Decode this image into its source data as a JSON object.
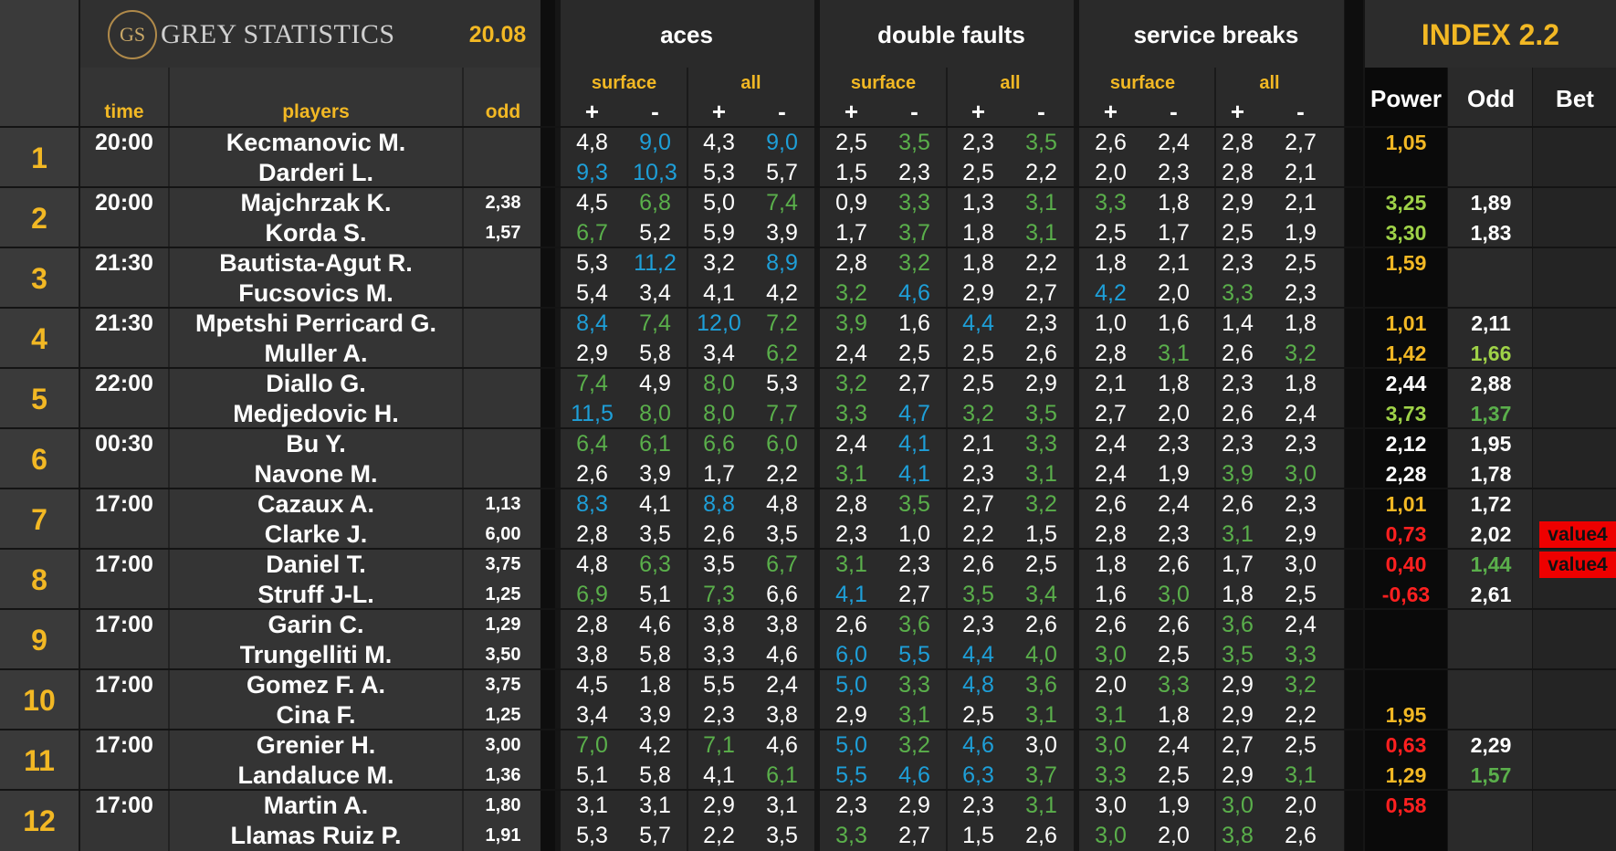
{
  "header": {
    "logo_mark": "GS",
    "logo_text": "GREY STATISTICS",
    "date": "20.08",
    "groups": [
      "aces",
      "double faults",
      "service breaks"
    ],
    "subgroups": [
      "surface",
      "all"
    ],
    "signs": [
      "+",
      "-"
    ],
    "left": {
      "time": "time",
      "players": "players",
      "odd": "odd"
    },
    "index_title": "INDEX 2.2",
    "right": {
      "power": "Power",
      "odd": "Odd",
      "bet": "Bet"
    }
  },
  "colors": {
    "white": "#ffffff",
    "green": "#5aaf4b",
    "blue": "#1e9fd8",
    "yellow": "#f2b824",
    "light_green": "#9fd248",
    "red": "#ff2020",
    "bet_bg": "#ee0000"
  },
  "matches": [
    {
      "no": "1",
      "time": "20:00",
      "players": [
        {
          "name": "Kecmanovic M.",
          "odd": "",
          "stats": [
            "4,8",
            "9,0",
            "4,3",
            "9,0",
            "2,5",
            "3,5",
            "2,3",
            "3,5",
            "2,6",
            "2,4",
            "2,8",
            "2,7"
          ],
          "colors": [
            "w",
            "b",
            "w",
            "b",
            "w",
            "g",
            "w",
            "g",
            "w",
            "w",
            "w",
            "w"
          ],
          "power": "1,05",
          "power_color": "yellow",
          "odd2": "",
          "odd2_color": "white",
          "bet": ""
        },
        {
          "name": "Darderi L.",
          "odd": "",
          "stats": [
            "9,3",
            "10,3",
            "5,3",
            "5,7",
            "1,5",
            "2,3",
            "2,5",
            "2,2",
            "2,0",
            "2,3",
            "2,8",
            "2,1"
          ],
          "colors": [
            "b",
            "b",
            "w",
            "w",
            "w",
            "w",
            "w",
            "w",
            "w",
            "w",
            "w",
            "w"
          ],
          "power": "",
          "power_color": "white",
          "odd2": "",
          "odd2_color": "white",
          "bet": ""
        }
      ]
    },
    {
      "no": "2",
      "time": "20:00",
      "players": [
        {
          "name": "Majchrzak K.",
          "odd": "2,38",
          "stats": [
            "4,5",
            "6,8",
            "5,0",
            "7,4",
            "0,9",
            "3,3",
            "1,3",
            "3,1",
            "3,3",
            "1,8",
            "2,9",
            "2,1"
          ],
          "colors": [
            "w",
            "g",
            "w",
            "g",
            "w",
            "g",
            "w",
            "g",
            "g",
            "w",
            "w",
            "w"
          ],
          "power": "3,25",
          "power_color": "light_green",
          "odd2": "1,89",
          "odd2_color": "white",
          "bet": ""
        },
        {
          "name": "Korda S.",
          "odd": "1,57",
          "stats": [
            "6,7",
            "5,2",
            "5,9",
            "3,9",
            "1,7",
            "3,7",
            "1,8",
            "3,1",
            "2,5",
            "1,7",
            "2,5",
            "1,9"
          ],
          "colors": [
            "g",
            "w",
            "w",
            "w",
            "w",
            "g",
            "w",
            "g",
            "w",
            "w",
            "w",
            "w"
          ],
          "power": "3,30",
          "power_color": "light_green",
          "odd2": "1,83",
          "odd2_color": "white",
          "bet": ""
        }
      ]
    },
    {
      "no": "3",
      "time": "21:30",
      "players": [
        {
          "name": "Bautista-Agut R.",
          "odd": "",
          "stats": [
            "5,3",
            "11,2",
            "3,2",
            "8,9",
            "2,8",
            "3,2",
            "1,8",
            "2,2",
            "1,8",
            "2,1",
            "2,3",
            "2,5"
          ],
          "colors": [
            "w",
            "b",
            "w",
            "b",
            "w",
            "g",
            "w",
            "w",
            "w",
            "w",
            "w",
            "w"
          ],
          "power": "1,59",
          "power_color": "yellow",
          "odd2": "",
          "odd2_color": "white",
          "bet": ""
        },
        {
          "name": "Fucsovics M.",
          "odd": "",
          "stats": [
            "5,4",
            "3,4",
            "4,1",
            "4,2",
            "3,2",
            "4,6",
            "2,9",
            "2,7",
            "4,2",
            "2,0",
            "3,3",
            "2,3"
          ],
          "colors": [
            "w",
            "w",
            "w",
            "w",
            "g",
            "b",
            "w",
            "w",
            "b",
            "w",
            "g",
            "w"
          ],
          "power": "",
          "power_color": "white",
          "odd2": "",
          "odd2_color": "white",
          "bet": ""
        }
      ]
    },
    {
      "no": "4",
      "time": "21:30",
      "players": [
        {
          "name": "Mpetshi Perricard G.",
          "odd": "",
          "stats": [
            "8,4",
            "7,4",
            "12,0",
            "7,2",
            "3,9",
            "1,6",
            "4,4",
            "2,3",
            "1,0",
            "1,6",
            "1,4",
            "1,8"
          ],
          "colors": [
            "b",
            "g",
            "b",
            "g",
            "g",
            "w",
            "b",
            "w",
            "w",
            "w",
            "w",
            "w"
          ],
          "power": "1,01",
          "power_color": "yellow",
          "odd2": "2,11",
          "odd2_color": "white",
          "bet": ""
        },
        {
          "name": "Muller A.",
          "odd": "",
          "stats": [
            "2,9",
            "5,8",
            "3,4",
            "6,2",
            "2,4",
            "2,5",
            "2,5",
            "2,6",
            "2,8",
            "3,1",
            "2,6",
            "3,2"
          ],
          "colors": [
            "w",
            "w",
            "w",
            "g",
            "w",
            "w",
            "w",
            "w",
            "w",
            "g",
            "w",
            "g"
          ],
          "power": "1,42",
          "power_color": "yellow",
          "odd2": "1,66",
          "odd2_color": "light_green",
          "bet": ""
        }
      ]
    },
    {
      "no": "5",
      "time": "22:00",
      "players": [
        {
          "name": "Diallo G.",
          "odd": "",
          "stats": [
            "7,4",
            "4,9",
            "8,0",
            "5,3",
            "3,2",
            "2,7",
            "2,5",
            "2,9",
            "2,1",
            "1,8",
            "2,3",
            "1,8"
          ],
          "colors": [
            "g",
            "w",
            "g",
            "w",
            "g",
            "w",
            "w",
            "w",
            "w",
            "w",
            "w",
            "w"
          ],
          "power": "2,44",
          "power_color": "white",
          "odd2": "2,88",
          "odd2_color": "white",
          "bet": ""
        },
        {
          "name": "Medjedovic H.",
          "odd": "",
          "stats": [
            "11,5",
            "8,0",
            "8,0",
            "7,7",
            "3,3",
            "4,7",
            "3,2",
            "3,5",
            "2,7",
            "2,0",
            "2,6",
            "2,4"
          ],
          "colors": [
            "b",
            "g",
            "g",
            "g",
            "g",
            "b",
            "g",
            "g",
            "w",
            "w",
            "w",
            "w"
          ],
          "power": "3,73",
          "power_color": "light_green",
          "odd2": "1,37",
          "odd2_color": "green",
          "bet": ""
        }
      ]
    },
    {
      "no": "6",
      "time": "00:30",
      "players": [
        {
          "name": "Bu Y.",
          "odd": "",
          "stats": [
            "6,4",
            "6,1",
            "6,6",
            "6,0",
            "2,4",
            "4,1",
            "2,1",
            "3,3",
            "2,4",
            "2,3",
            "2,3",
            "2,3"
          ],
          "colors": [
            "g",
            "g",
            "g",
            "g",
            "w",
            "b",
            "w",
            "g",
            "w",
            "w",
            "w",
            "w"
          ],
          "power": "2,12",
          "power_color": "white",
          "odd2": "1,95",
          "odd2_color": "white",
          "bet": ""
        },
        {
          "name": "Navone M.",
          "odd": "",
          "stats": [
            "2,6",
            "3,9",
            "1,7",
            "2,2",
            "3,1",
            "4,1",
            "2,3",
            "3,1",
            "2,4",
            "1,9",
            "3,9",
            "3,0"
          ],
          "colors": [
            "w",
            "w",
            "w",
            "w",
            "g",
            "b",
            "w",
            "g",
            "w",
            "w",
            "g",
            "g"
          ],
          "power": "2,28",
          "power_color": "white",
          "odd2": "1,78",
          "odd2_color": "white",
          "bet": ""
        }
      ]
    },
    {
      "no": "7",
      "time": "17:00",
      "players": [
        {
          "name": "Cazaux A.",
          "odd": "1,13",
          "stats": [
            "8,3",
            "4,1",
            "8,8",
            "4,8",
            "2,8",
            "3,5",
            "2,7",
            "3,2",
            "2,6",
            "2,4",
            "2,6",
            "2,3"
          ],
          "colors": [
            "b",
            "w",
            "b",
            "w",
            "w",
            "g",
            "w",
            "g",
            "w",
            "w",
            "w",
            "w"
          ],
          "power": "1,01",
          "power_color": "yellow",
          "odd2": "1,72",
          "odd2_color": "white",
          "bet": ""
        },
        {
          "name": "Clarke J.",
          "odd": "6,00",
          "stats": [
            "2,8",
            "3,5",
            "2,6",
            "3,5",
            "2,3",
            "1,0",
            "2,2",
            "1,5",
            "2,8",
            "2,3",
            "3,1",
            "2,9"
          ],
          "colors": [
            "w",
            "w",
            "w",
            "w",
            "w",
            "w",
            "w",
            "w",
            "w",
            "w",
            "g",
            "w"
          ],
          "power": "0,73",
          "power_color": "red",
          "odd2": "2,02",
          "odd2_color": "white",
          "bet": "value4"
        }
      ]
    },
    {
      "no": "8",
      "time": "17:00",
      "players": [
        {
          "name": "Daniel T.",
          "odd": "3,75",
          "stats": [
            "4,8",
            "6,3",
            "3,5",
            "6,7",
            "3,1",
            "2,3",
            "2,6",
            "2,5",
            "1,8",
            "2,6",
            "1,7",
            "3,0"
          ],
          "colors": [
            "w",
            "g",
            "w",
            "g",
            "g",
            "w",
            "w",
            "w",
            "w",
            "w",
            "w",
            "w"
          ],
          "power": "0,40",
          "power_color": "red",
          "odd2": "1,44",
          "odd2_color": "green",
          "bet": "value4"
        },
        {
          "name": "Struff J-L.",
          "odd": "1,25",
          "stats": [
            "6,9",
            "5,1",
            "7,3",
            "6,6",
            "4,1",
            "2,7",
            "3,5",
            "3,4",
            "1,6",
            "3,0",
            "1,8",
            "2,5"
          ],
          "colors": [
            "g",
            "w",
            "g",
            "w",
            "b",
            "w",
            "g",
            "g",
            "w",
            "g",
            "w",
            "w"
          ],
          "power": "-0,63",
          "power_color": "red",
          "odd2": "2,61",
          "odd2_color": "white",
          "bet": ""
        }
      ]
    },
    {
      "no": "9",
      "time": "17:00",
      "players": [
        {
          "name": "Garin C.",
          "odd": "1,29",
          "stats": [
            "2,8",
            "4,6",
            "3,8",
            "3,8",
            "2,6",
            "3,6",
            "2,3",
            "2,6",
            "2,6",
            "2,6",
            "3,6",
            "2,4"
          ],
          "colors": [
            "w",
            "w",
            "w",
            "w",
            "w",
            "g",
            "w",
            "w",
            "w",
            "w",
            "g",
            "w"
          ],
          "power": "",
          "power_color": "white",
          "odd2": "",
          "odd2_color": "white",
          "bet": ""
        },
        {
          "name": "Trungelliti M.",
          "odd": "3,50",
          "stats": [
            "3,8",
            "5,8",
            "3,3",
            "4,6",
            "6,0",
            "5,5",
            "4,4",
            "4,0",
            "3,0",
            "2,5",
            "3,5",
            "3,3"
          ],
          "colors": [
            "w",
            "w",
            "w",
            "w",
            "b",
            "b",
            "b",
            "g",
            "g",
            "w",
            "g",
            "g"
          ],
          "power": "",
          "power_color": "white",
          "odd2": "",
          "odd2_color": "white",
          "bet": ""
        }
      ]
    },
    {
      "no": "10",
      "time": "17:00",
      "players": [
        {
          "name": "Gomez F. A.",
          "odd": "3,75",
          "stats": [
            "4,5",
            "1,8",
            "5,5",
            "2,4",
            "5,0",
            "3,3",
            "4,8",
            "3,6",
            "2,0",
            "3,3",
            "2,9",
            "3,2"
          ],
          "colors": [
            "w",
            "w",
            "w",
            "w",
            "b",
            "g",
            "b",
            "g",
            "w",
            "g",
            "w",
            "g"
          ],
          "power": "",
          "power_color": "white",
          "odd2": "",
          "odd2_color": "white",
          "bet": ""
        },
        {
          "name": "Cina F.",
          "odd": "1,25",
          "stats": [
            "3,4",
            "3,9",
            "2,3",
            "3,8",
            "2,9",
            "3,1",
            "2,5",
            "3,1",
            "3,1",
            "1,8",
            "2,9",
            "2,2"
          ],
          "colors": [
            "w",
            "w",
            "w",
            "w",
            "w",
            "g",
            "w",
            "g",
            "g",
            "w",
            "w",
            "w"
          ],
          "power": "1,95",
          "power_color": "yellow",
          "odd2": "",
          "odd2_color": "white",
          "bet": ""
        }
      ]
    },
    {
      "no": "11",
      "time": "17:00",
      "players": [
        {
          "name": "Grenier H.",
          "odd": "3,00",
          "stats": [
            "7,0",
            "4,2",
            "7,1",
            "4,6",
            "5,0",
            "3,2",
            "4,6",
            "3,0",
            "3,0",
            "2,4",
            "2,7",
            "2,5"
          ],
          "colors": [
            "g",
            "w",
            "g",
            "w",
            "b",
            "g",
            "b",
            "w",
            "g",
            "w",
            "w",
            "w"
          ],
          "power": "0,63",
          "power_color": "red",
          "odd2": "2,29",
          "odd2_color": "white",
          "bet": ""
        },
        {
          "name": "Landaluce M.",
          "odd": "1,36",
          "stats": [
            "5,1",
            "5,8",
            "4,1",
            "6,1",
            "5,5",
            "4,6",
            "6,3",
            "3,7",
            "3,3",
            "2,5",
            "2,9",
            "3,1"
          ],
          "colors": [
            "w",
            "w",
            "w",
            "g",
            "b",
            "b",
            "b",
            "g",
            "g",
            "w",
            "w",
            "g"
          ],
          "power": "1,29",
          "power_color": "yellow",
          "odd2": "1,57",
          "odd2_color": "green",
          "bet": ""
        }
      ]
    },
    {
      "no": "12",
      "time": "17:00",
      "players": [
        {
          "name": "Martin A.",
          "odd": "1,80",
          "stats": [
            "3,1",
            "3,1",
            "2,9",
            "3,1",
            "2,3",
            "2,9",
            "2,3",
            "3,1",
            "3,0",
            "1,9",
            "3,0",
            "2,0"
          ],
          "colors": [
            "w",
            "w",
            "w",
            "w",
            "w",
            "w",
            "w",
            "g",
            "w",
            "w",
            "g",
            "w"
          ],
          "power": "0,58",
          "power_color": "red",
          "odd2": "",
          "odd2_color": "white",
          "bet": ""
        },
        {
          "name": "Llamas Ruiz P.",
          "odd": "1,91",
          "stats": [
            "5,3",
            "5,7",
            "2,2",
            "3,5",
            "3,3",
            "2,7",
            "1,5",
            "2,6",
            "3,0",
            "2,0",
            "3,8",
            "2,6"
          ],
          "colors": [
            "w",
            "w",
            "w",
            "w",
            "g",
            "w",
            "w",
            "w",
            "g",
            "w",
            "g",
            "w"
          ],
          "power": "",
          "power_color": "white",
          "odd2": "",
          "odd2_color": "white",
          "bet": ""
        }
      ]
    }
  ]
}
